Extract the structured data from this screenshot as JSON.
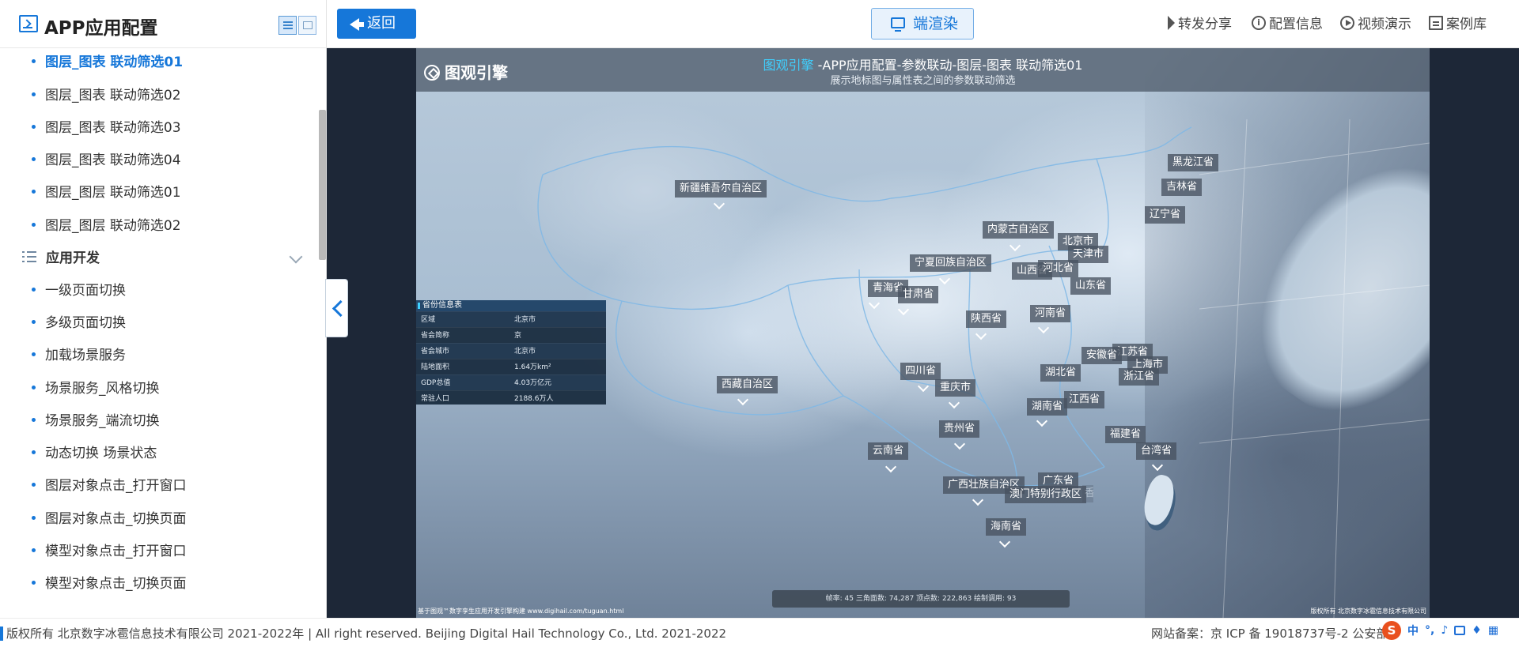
{
  "sidebar": {
    "title": "APP应用配置",
    "items_top": [
      {
        "label": "图层_图表 联动筛选01",
        "active": true
      },
      {
        "label": "图层_图表 联动筛选02"
      },
      {
        "label": "图层_图表 联动筛选03"
      },
      {
        "label": "图层_图表 联动筛选04"
      },
      {
        "label": "图层_图层 联动筛选01"
      },
      {
        "label": "图层_图层 联动筛选02"
      }
    ],
    "group": {
      "label": "应用开发",
      "expanded": true
    },
    "items_dev": [
      {
        "label": "一级页面切换"
      },
      {
        "label": "多级页面切换"
      },
      {
        "label": "加载场景服务"
      },
      {
        "label": "场景服务_风格切换"
      },
      {
        "label": "场景服务_端流切换"
      },
      {
        "label": "动态切换 场景状态"
      },
      {
        "label": "图层对象点击_打开窗口"
      },
      {
        "label": "图层对象点击_切换页面"
      },
      {
        "label": "模型对象点击_打开窗口"
      },
      {
        "label": "模型对象点击_切换页面"
      }
    ]
  },
  "toolbar": {
    "back_label": "返回",
    "render_label": "端渲染",
    "links": [
      {
        "label": "转发分享",
        "icon": "share-icon"
      },
      {
        "label": "配置信息",
        "icon": "info-icon"
      },
      {
        "label": "视频演示",
        "icon": "play-icon"
      },
      {
        "label": "案例库",
        "icon": "library-icon"
      }
    ]
  },
  "scene": {
    "brand": "图观引擎",
    "title_highlight": "图观引擎",
    "title_rest": " -APP应用配置-参数联动-图层-图表 联动筛选01",
    "subtitle": "展示地标图与属性表之间的参数联动筛选",
    "provinces": [
      "新疆维吾尔自治区",
      "黑龙江省",
      "吉林省",
      "辽宁省",
      "内蒙古自治区",
      "北京市",
      "天津市",
      "宁夏回族自治区",
      "山西省",
      "河北省",
      "青海省",
      "甘肃省",
      "山东省",
      "陕西省",
      "河南省",
      "江苏省",
      "安徽省",
      "上海市",
      "四川省",
      "湖北省",
      "浙江省",
      "西藏自治区",
      "重庆市",
      "湖南省",
      "江西省",
      "贵州省",
      "福建省",
      "云南省",
      "台湾省",
      "广西壮族自治区",
      "广东省",
      "澳门特别行政区",
      "香港特别行政区",
      "海南省"
    ],
    "info_panel": {
      "title": "省份信息表",
      "rows": [
        {
          "k": "区域",
          "v": "北京市"
        },
        {
          "k": "省会简称",
          "v": "京"
        },
        {
          "k": "省会城市",
          "v": "北京市"
        },
        {
          "k": "陆地面积",
          "v": "1.64万km²"
        },
        {
          "k": "GDP总值",
          "v": "4.03万亿元"
        },
        {
          "k": "常驻人口",
          "v": "2188.6万人"
        }
      ]
    },
    "stats": "帧率: 45     三角面数: 74,287     顶点数: 222,863     绘制调用: 93",
    "footer_left": "基于图观™数字孪生应用开发引擎构建 www.digihail.com/tuguan.html",
    "footer_right": "版权所有 北京数字冰雹信息技术有限公司"
  },
  "footer": {
    "copyright": "版权所有 北京数字冰雹信息技术有限公司 2021-2022年 | All right reserved. Beijing Digital Hail Technology Co., Ltd. 2021-2022",
    "icp": "网站备案：京 ICP 备 19018737号-2 公安部"
  },
  "ime": {
    "logo": "S",
    "lang": "中"
  },
  "colors": {
    "accent": "#1677d9",
    "highlight": "#3fd0ff"
  }
}
